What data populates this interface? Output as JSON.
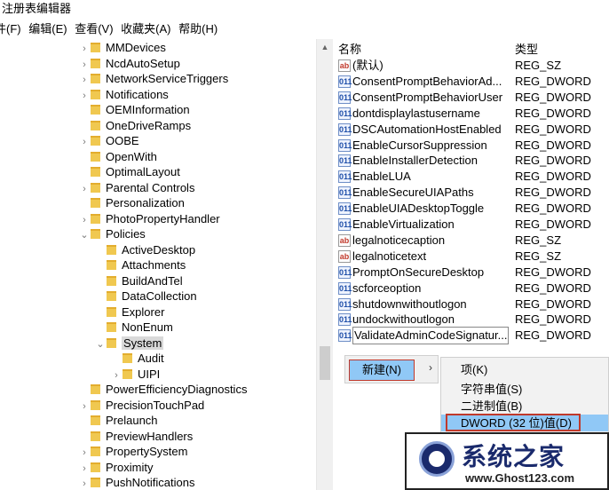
{
  "window": {
    "title": "注册表编辑器"
  },
  "menubar": [
    "件(F)",
    "编辑(E)",
    "查看(V)",
    "收藏夹(A)",
    "帮助(H)"
  ],
  "tree": {
    "items": [
      {
        "label": "MMDevices",
        "chev": "›"
      },
      {
        "label": "NcdAutoSetup",
        "chev": "›"
      },
      {
        "label": "NetworkServiceTriggers",
        "chev": "›"
      },
      {
        "label": "Notifications",
        "chev": "›"
      },
      {
        "label": "OEMInformation",
        "chev": ""
      },
      {
        "label": "OneDriveRamps",
        "chev": ""
      },
      {
        "label": "OOBE",
        "chev": "›"
      },
      {
        "label": "OpenWith",
        "chev": ""
      },
      {
        "label": "OptimalLayout",
        "chev": ""
      },
      {
        "label": "Parental Controls",
        "chev": "›"
      },
      {
        "label": "Personalization",
        "chev": ""
      },
      {
        "label": "PhotoPropertyHandler",
        "chev": "›"
      },
      {
        "label": "Policies",
        "chev": "⌄"
      },
      {
        "label": "ActiveDesktop",
        "chev": ""
      },
      {
        "label": "Attachments",
        "chev": ""
      },
      {
        "label": "BuildAndTel",
        "chev": ""
      },
      {
        "label": "DataCollection",
        "chev": ""
      },
      {
        "label": "Explorer",
        "chev": ""
      },
      {
        "label": "NonEnum",
        "chev": ""
      },
      {
        "label": "System",
        "chev": "⌄",
        "selected": true
      },
      {
        "label": "Audit",
        "chev": ""
      },
      {
        "label": "UIPI",
        "chev": "›"
      },
      {
        "label": "PowerEfficiencyDiagnostics",
        "chev": ""
      },
      {
        "label": "PrecisionTouchPad",
        "chev": "›"
      },
      {
        "label": "Prelaunch",
        "chev": ""
      },
      {
        "label": "PreviewHandlers",
        "chev": ""
      },
      {
        "label": "PropertySystem",
        "chev": "›"
      },
      {
        "label": "Proximity",
        "chev": "›"
      },
      {
        "label": "PushNotifications",
        "chev": "›"
      }
    ]
  },
  "list": {
    "header": {
      "name": "名称",
      "type": "类型"
    },
    "rows": [
      {
        "name": "(默认)",
        "type": "REG_SZ",
        "icon": "ab"
      },
      {
        "name": "ConsentPromptBehaviorAd...",
        "type": "REG_DWORD",
        "icon": "dw"
      },
      {
        "name": "ConsentPromptBehaviorUser",
        "type": "REG_DWORD",
        "icon": "dw"
      },
      {
        "name": "dontdisplaylastusername",
        "type": "REG_DWORD",
        "icon": "dw"
      },
      {
        "name": "DSCAutomationHostEnabled",
        "type": "REG_DWORD",
        "icon": "dw"
      },
      {
        "name": "EnableCursorSuppression",
        "type": "REG_DWORD",
        "icon": "dw"
      },
      {
        "name": "EnableInstallerDetection",
        "type": "REG_DWORD",
        "icon": "dw"
      },
      {
        "name": "EnableLUA",
        "type": "REG_DWORD",
        "icon": "dw"
      },
      {
        "name": "EnableSecureUIAPaths",
        "type": "REG_DWORD",
        "icon": "dw"
      },
      {
        "name": "EnableUIADesktopToggle",
        "type": "REG_DWORD",
        "icon": "dw"
      },
      {
        "name": "EnableVirtualization",
        "type": "REG_DWORD",
        "icon": "dw"
      },
      {
        "name": "legalnoticecaption",
        "type": "REG_SZ",
        "icon": "ab"
      },
      {
        "name": "legalnoticetext",
        "type": "REG_SZ",
        "icon": "ab"
      },
      {
        "name": "PromptOnSecureDesktop",
        "type": "REG_DWORD",
        "icon": "dw"
      },
      {
        "name": "scforceoption",
        "type": "REG_DWORD",
        "icon": "dw"
      },
      {
        "name": "shutdownwithoutlogon",
        "type": "REG_DWORD",
        "icon": "dw"
      },
      {
        "name": "undockwithoutlogon",
        "type": "REG_DWORD",
        "icon": "dw"
      },
      {
        "name": "ValidateAdminCodeSignatur...",
        "type": "REG_DWORD",
        "icon": "dw",
        "boxed": true
      }
    ]
  },
  "context_menu": {
    "new_label": "新建(N)",
    "arrow": "›",
    "submenu": [
      "项(K)",
      "字符串值(S)",
      "二进制值(B)",
      "DWORD (32 位)值(D)"
    ]
  },
  "watermark": {
    "title": "系统之家",
    "url": "www.Ghost123.com"
  },
  "icons": {
    "string_value": "ab",
    "dword_value": "011"
  },
  "colors": {
    "highlight": "#90c8f6",
    "annotation_red": "#c0392b",
    "folder": "#f0c850"
  }
}
